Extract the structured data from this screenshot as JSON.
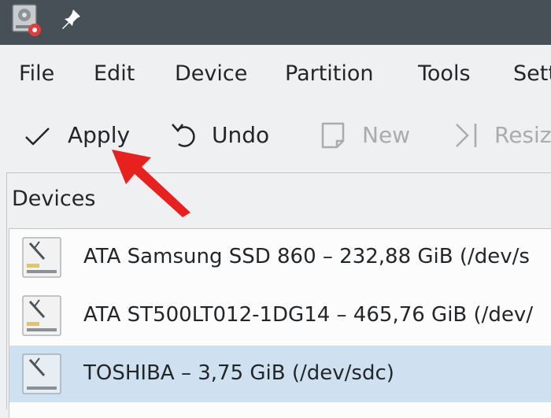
{
  "menu": {
    "items": [
      "File",
      "Edit",
      "Device",
      "Partition",
      "Tools",
      "Sett"
    ]
  },
  "toolbar": {
    "apply_label": "Apply",
    "undo_label": "Undo",
    "new_label": "New",
    "resize_label": "Resiz"
  },
  "devices": {
    "title": "Devices",
    "list": [
      {
        "label": "ATA Samsung SSD 860 – 232,88 GiB (/dev/s"
      },
      {
        "label": "ATA ST500LT012-1DG14 – 465,76 GiB (/dev/"
      },
      {
        "label": "TOSHIBA  – 3,75 GiB (/dev/sdc)"
      }
    ]
  },
  "colors": {
    "titlebar": "#475057",
    "background": "#eff0f1",
    "selection": "#cfe1f0",
    "annotation_arrow": "#e8211e"
  }
}
